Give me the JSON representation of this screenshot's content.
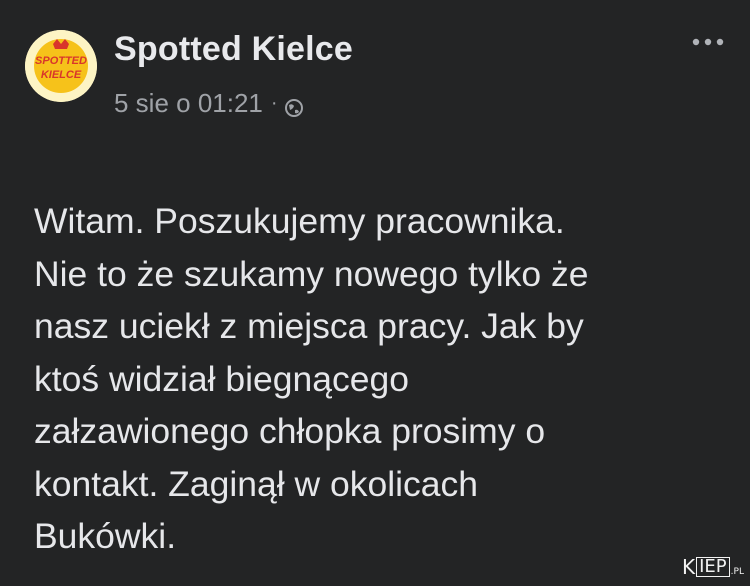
{
  "post": {
    "page_name": "Spotted Kielce",
    "avatar_text": [
      "SPOTTED",
      "KIELCE"
    ],
    "timestamp": "5 sie o 01:21",
    "separator": "·",
    "audience_icon": "globe-icon",
    "more_icon": "more-options-icon",
    "body_text": "Witam. Poszukujemy pracownika.\nNie to że szukamy nowego tylko że\nnasz uciekł z miejsca pracy. Jak by\nktoś widział biegnącego\nzałzawionego chłopka prosimy o\nkontakt. Zaginął w okolicach\nBukówki."
  },
  "watermark": {
    "k": "K",
    "box": "IEP",
    "pl": ".PL"
  },
  "colors": {
    "background": "#242526",
    "text": "#e4e6eb",
    "secondary_text": "#9fa2a7",
    "avatar_bg": "#fdf4c4",
    "avatar_accent": "#f6c21a",
    "avatar_text": "#d9362b"
  }
}
